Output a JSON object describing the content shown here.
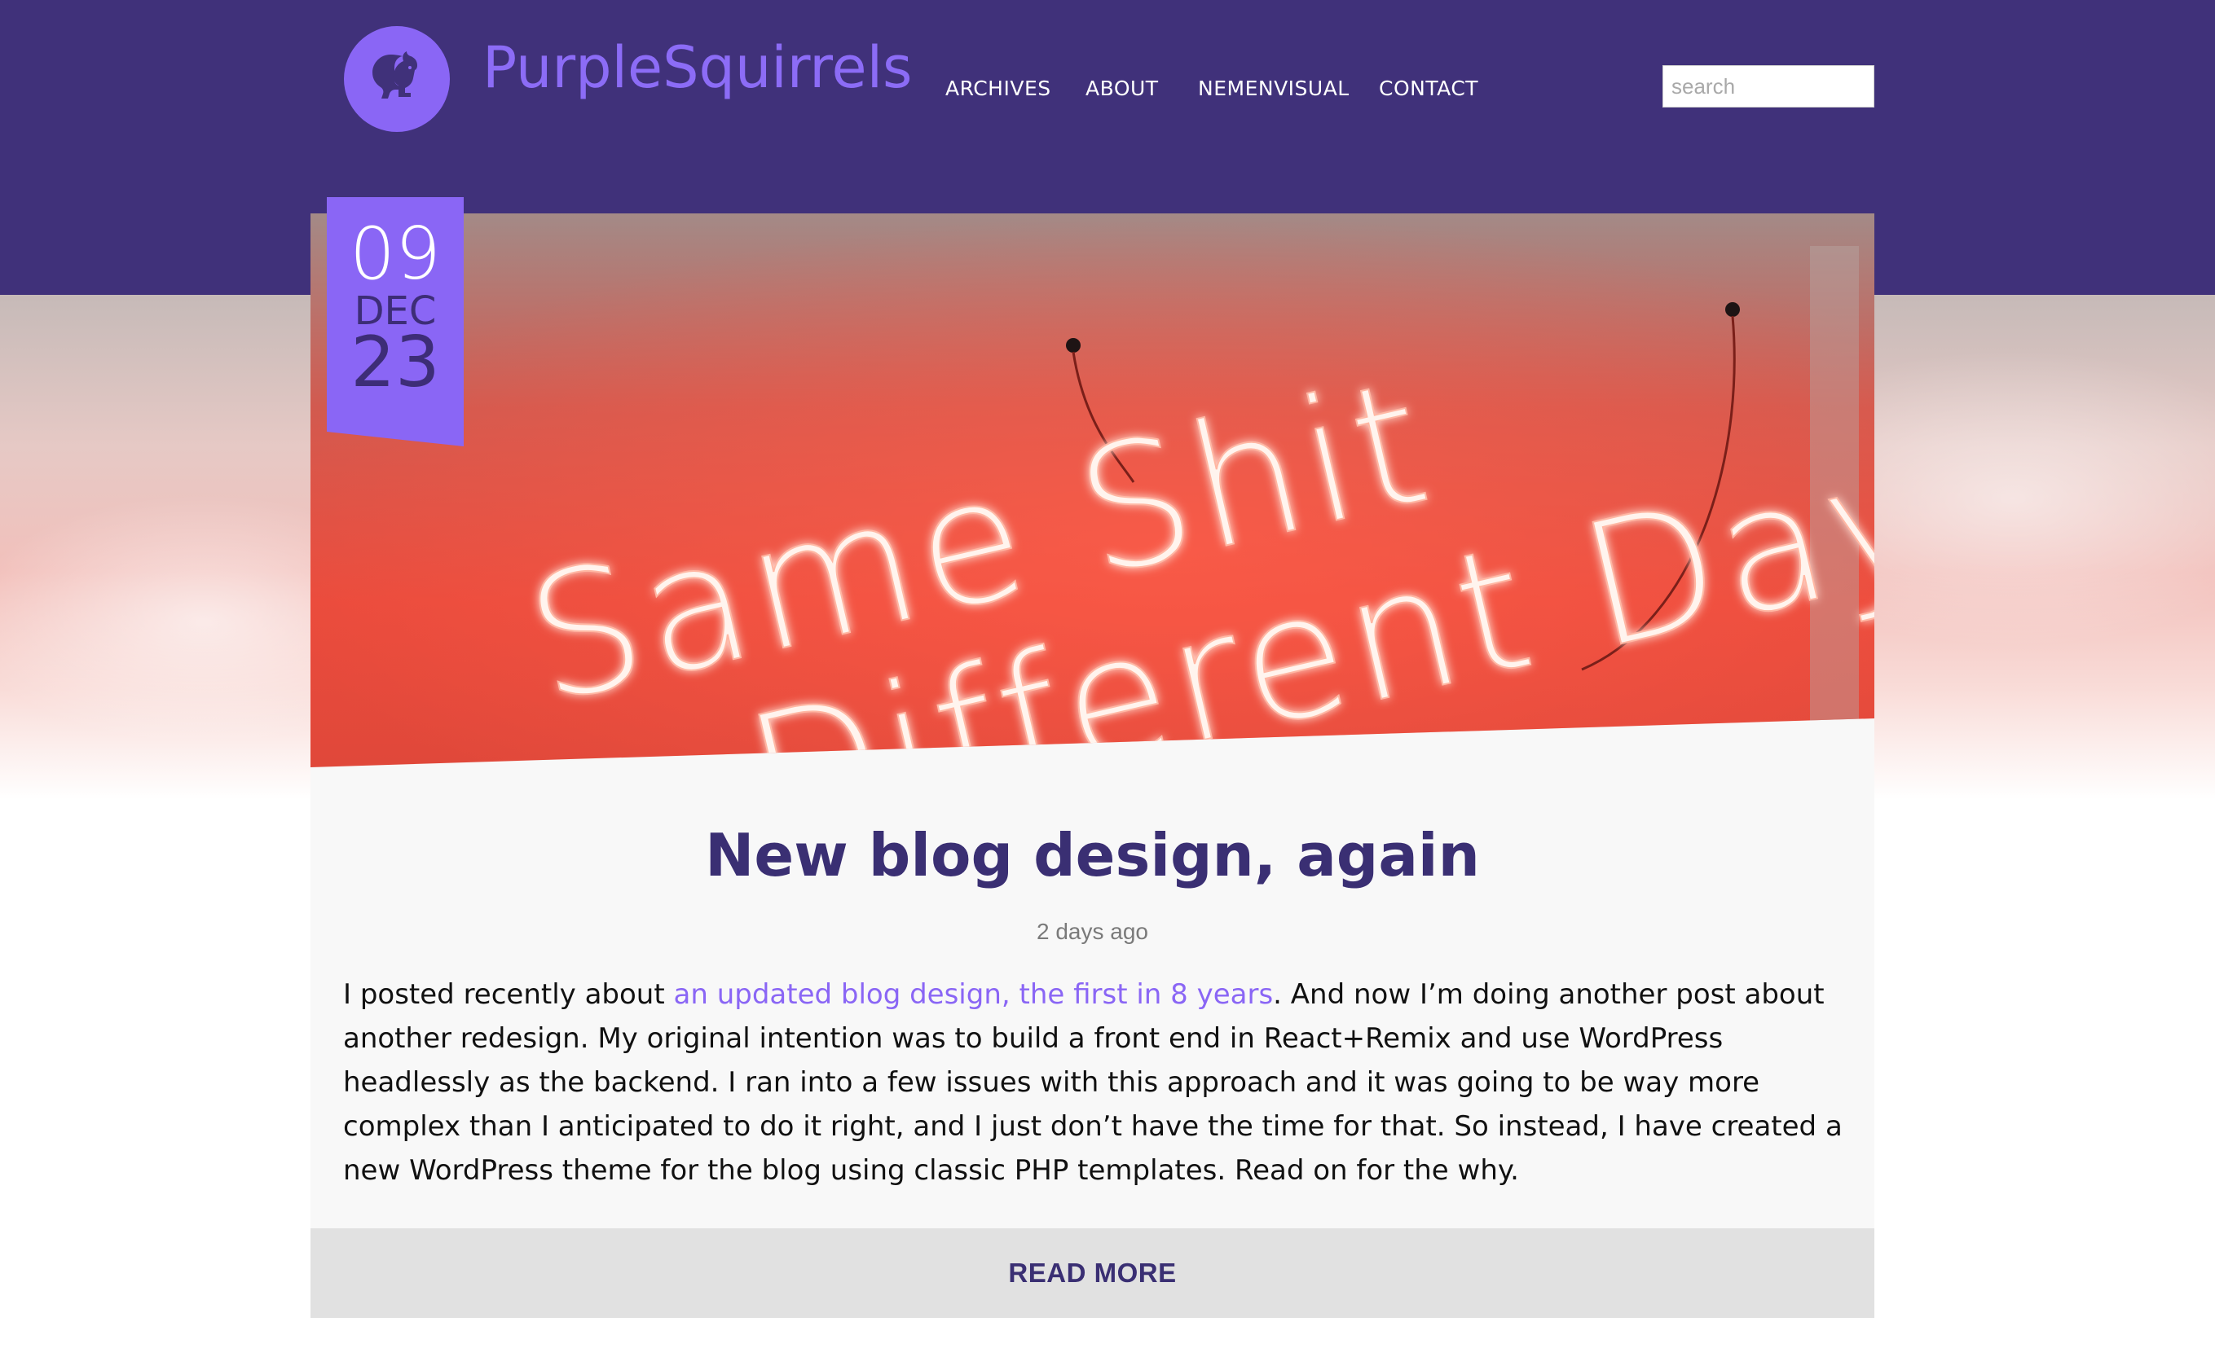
{
  "site": {
    "brand": "PurpleSquirrels",
    "logo_icon": "squirrel-icon"
  },
  "nav": {
    "items": [
      {
        "label": "ARCHIVES"
      },
      {
        "label": "ABOUT"
      },
      {
        "label": "NEMENVISUAL"
      },
      {
        "label": "CONTACT"
      }
    ]
  },
  "search": {
    "placeholder": "search",
    "value": ""
  },
  "post": {
    "date": {
      "day": "09",
      "month": "DEC",
      "year": "23"
    },
    "hero": {
      "sign_line_1": "Same Shit",
      "sign_line_2": "Different Day"
    },
    "title": "New blog design, again",
    "meta": "2 days ago",
    "excerpt_before": "I posted recently about ",
    "excerpt_link": "an updated blog design, the first in 8 years",
    "excerpt_after": ". And now I’m doing another post about another redesign. My original intention was to build a front end in React+Remix and use WordPress headlessly as the backend. I ran into a few issues with this approach and it was going to be way more complex than I anticipated to do it right, and I just don’t have the time for that. So instead, I have created a new WordPress theme for the blog using classic PHP templates. Read on for the why.",
    "read_more": "READ MORE"
  },
  "colors": {
    "header": "#40317a",
    "accent": "#8a66f5",
    "title": "#3a2f73",
    "read_more_bg": "#e1e1e1"
  }
}
